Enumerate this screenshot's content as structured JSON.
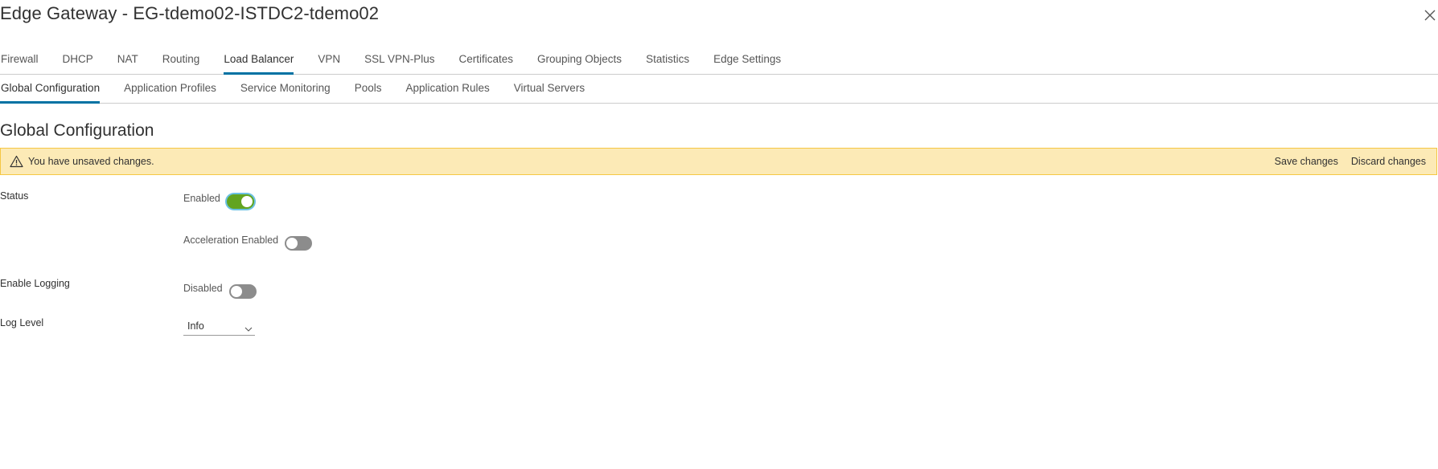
{
  "dialog": {
    "title": "Edge Gateway - EG-tdemo02-ISTDC2-tdemo02",
    "close_icon": "close-icon"
  },
  "primary_tabs": [
    {
      "label": "Firewall",
      "active": false
    },
    {
      "label": "DHCP",
      "active": false
    },
    {
      "label": "NAT",
      "active": false
    },
    {
      "label": "Routing",
      "active": false
    },
    {
      "label": "Load Balancer",
      "active": true
    },
    {
      "label": "VPN",
      "active": false
    },
    {
      "label": "SSL VPN-Plus",
      "active": false
    },
    {
      "label": "Certificates",
      "active": false
    },
    {
      "label": "Grouping Objects",
      "active": false
    },
    {
      "label": "Statistics",
      "active": false
    },
    {
      "label": "Edge Settings",
      "active": false
    }
  ],
  "secondary_tabs": [
    {
      "label": "Global Configuration",
      "active": true
    },
    {
      "label": "Application Profiles",
      "active": false
    },
    {
      "label": "Service Monitoring",
      "active": false
    },
    {
      "label": "Pools",
      "active": false
    },
    {
      "label": "Application Rules",
      "active": false
    },
    {
      "label": "Virtual Servers",
      "active": false
    }
  ],
  "section": {
    "title": "Global Configuration"
  },
  "alert": {
    "icon": "warning-icon",
    "message": "You have unsaved changes.",
    "save_label": "Save changes",
    "discard_label": "Discard changes",
    "color": "#fceab6"
  },
  "form": {
    "status_label": "Status",
    "enabled_label": "Enabled",
    "enabled_on": true,
    "acceleration_label": "Acceleration Enabled",
    "acceleration_on": false,
    "logging_label": "Enable Logging",
    "logging_state_label": "Disabled",
    "logging_on": false,
    "log_level_label": "Log Level",
    "log_level_value": "Info"
  },
  "colors": {
    "toggle_on": "#62a420",
    "toggle_off": "#8c8c8c",
    "active_tab": "#0072a3"
  }
}
